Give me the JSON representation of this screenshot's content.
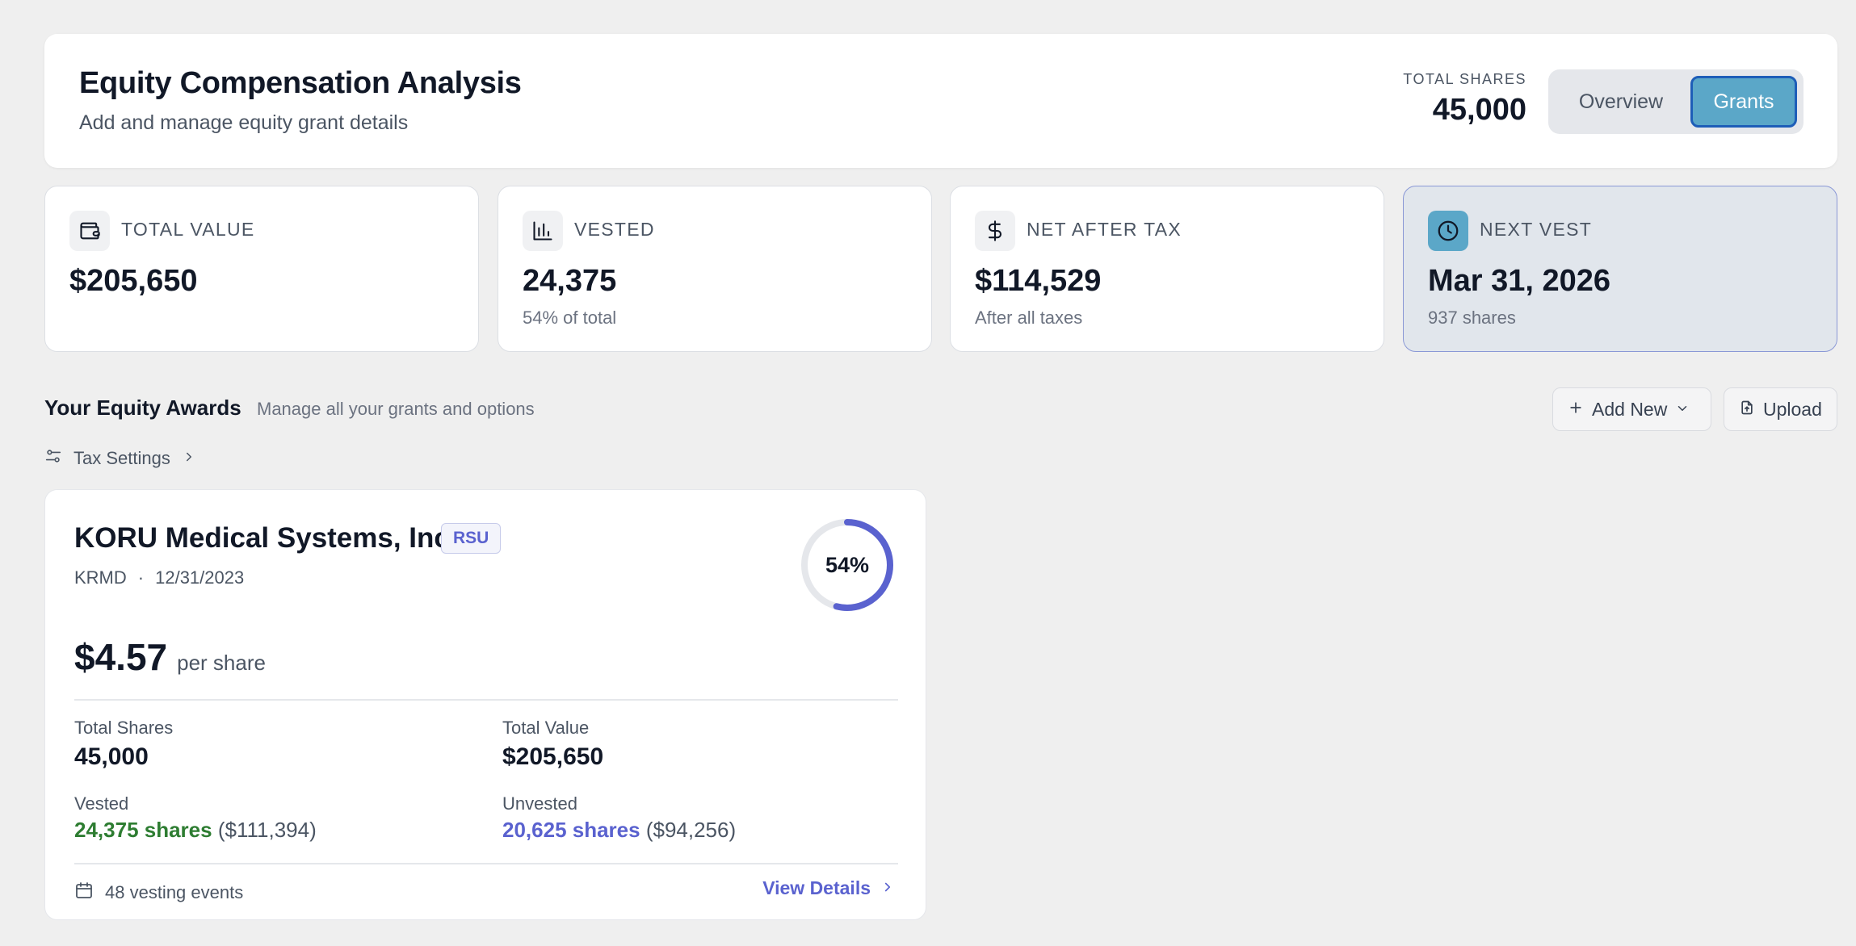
{
  "header": {
    "title": "Equity Compensation Analysis",
    "subtitle": "Add and manage equity grant details",
    "total_shares_label": "TOTAL SHARES",
    "total_shares_value": "45,000",
    "tabs": [
      {
        "label": "Overview",
        "active": false
      },
      {
        "label": "Grants",
        "active": true
      }
    ]
  },
  "stats": [
    {
      "label": "TOTAL VALUE",
      "value": "$205,650",
      "sub": "",
      "icon": "wallet-icon"
    },
    {
      "label": "VESTED",
      "value": "24,375",
      "sub": "54% of total",
      "icon": "bar-chart-icon"
    },
    {
      "label": "NET AFTER TAX",
      "value": "$114,529",
      "sub": "After all taxes",
      "icon": "dollar-icon"
    },
    {
      "label": "NEXT VEST",
      "value": "Mar 31, 2026",
      "sub": "937 shares",
      "icon": "clock-icon"
    }
  ],
  "section": {
    "title": "Your Equity Awards",
    "subtitle": "Manage all your grants and options",
    "add_new_label": "Add New",
    "upload_label": "Upload",
    "tax_settings_label": "Tax Settings"
  },
  "grant": {
    "company": "KORU Medical Systems, Inc.",
    "type": "RSU",
    "ticker": "KRMD",
    "separator": "·",
    "date": "12/31/2023",
    "progress_label": "54%",
    "progress_fraction": 0.54,
    "price": "$4.57",
    "price_unit": "per share",
    "total_shares_label": "Total Shares",
    "total_shares": "45,000",
    "total_value_label": "Total Value",
    "total_value": "$205,650",
    "vested_label": "Vested",
    "vested_shares": "24,375 shares",
    "vested_value": "($111,394)",
    "unvested_label": "Unvested",
    "unvested_shares": "20,625 shares",
    "unvested_value": "($94,256)",
    "events_label": "48 vesting events",
    "view_details_label": "View Details"
  },
  "colors": {
    "accent": "#5ba7c8",
    "indigo": "#5a62cf",
    "green": "#2e7d32",
    "background": "#efefef"
  }
}
